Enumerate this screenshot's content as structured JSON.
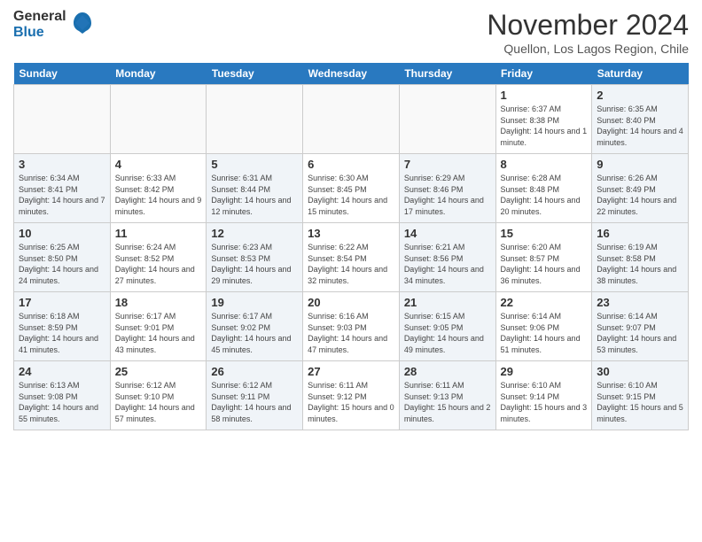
{
  "header": {
    "logo": {
      "general": "General",
      "blue": "Blue"
    },
    "title": "November 2024",
    "location": "Quellon, Los Lagos Region, Chile"
  },
  "weekdays": [
    "Sunday",
    "Monday",
    "Tuesday",
    "Wednesday",
    "Thursday",
    "Friday",
    "Saturday"
  ],
  "weeks": [
    [
      {
        "day": "",
        "info": ""
      },
      {
        "day": "",
        "info": ""
      },
      {
        "day": "",
        "info": ""
      },
      {
        "day": "",
        "info": ""
      },
      {
        "day": "",
        "info": ""
      },
      {
        "day": "1",
        "info": "Sunrise: 6:37 AM\nSunset: 8:38 PM\nDaylight: 14 hours and 1 minute."
      },
      {
        "day": "2",
        "info": "Sunrise: 6:35 AM\nSunset: 8:40 PM\nDaylight: 14 hours and 4 minutes."
      }
    ],
    [
      {
        "day": "3",
        "info": "Sunrise: 6:34 AM\nSunset: 8:41 PM\nDaylight: 14 hours and 7 minutes."
      },
      {
        "day": "4",
        "info": "Sunrise: 6:33 AM\nSunset: 8:42 PM\nDaylight: 14 hours and 9 minutes."
      },
      {
        "day": "5",
        "info": "Sunrise: 6:31 AM\nSunset: 8:44 PM\nDaylight: 14 hours and 12 minutes."
      },
      {
        "day": "6",
        "info": "Sunrise: 6:30 AM\nSunset: 8:45 PM\nDaylight: 14 hours and 15 minutes."
      },
      {
        "day": "7",
        "info": "Sunrise: 6:29 AM\nSunset: 8:46 PM\nDaylight: 14 hours and 17 minutes."
      },
      {
        "day": "8",
        "info": "Sunrise: 6:28 AM\nSunset: 8:48 PM\nDaylight: 14 hours and 20 minutes."
      },
      {
        "day": "9",
        "info": "Sunrise: 6:26 AM\nSunset: 8:49 PM\nDaylight: 14 hours and 22 minutes."
      }
    ],
    [
      {
        "day": "10",
        "info": "Sunrise: 6:25 AM\nSunset: 8:50 PM\nDaylight: 14 hours and 24 minutes."
      },
      {
        "day": "11",
        "info": "Sunrise: 6:24 AM\nSunset: 8:52 PM\nDaylight: 14 hours and 27 minutes."
      },
      {
        "day": "12",
        "info": "Sunrise: 6:23 AM\nSunset: 8:53 PM\nDaylight: 14 hours and 29 minutes."
      },
      {
        "day": "13",
        "info": "Sunrise: 6:22 AM\nSunset: 8:54 PM\nDaylight: 14 hours and 32 minutes."
      },
      {
        "day": "14",
        "info": "Sunrise: 6:21 AM\nSunset: 8:56 PM\nDaylight: 14 hours and 34 minutes."
      },
      {
        "day": "15",
        "info": "Sunrise: 6:20 AM\nSunset: 8:57 PM\nDaylight: 14 hours and 36 minutes."
      },
      {
        "day": "16",
        "info": "Sunrise: 6:19 AM\nSunset: 8:58 PM\nDaylight: 14 hours and 38 minutes."
      }
    ],
    [
      {
        "day": "17",
        "info": "Sunrise: 6:18 AM\nSunset: 8:59 PM\nDaylight: 14 hours and 41 minutes."
      },
      {
        "day": "18",
        "info": "Sunrise: 6:17 AM\nSunset: 9:01 PM\nDaylight: 14 hours and 43 minutes."
      },
      {
        "day": "19",
        "info": "Sunrise: 6:17 AM\nSunset: 9:02 PM\nDaylight: 14 hours and 45 minutes."
      },
      {
        "day": "20",
        "info": "Sunrise: 6:16 AM\nSunset: 9:03 PM\nDaylight: 14 hours and 47 minutes."
      },
      {
        "day": "21",
        "info": "Sunrise: 6:15 AM\nSunset: 9:05 PM\nDaylight: 14 hours and 49 minutes."
      },
      {
        "day": "22",
        "info": "Sunrise: 6:14 AM\nSunset: 9:06 PM\nDaylight: 14 hours and 51 minutes."
      },
      {
        "day": "23",
        "info": "Sunrise: 6:14 AM\nSunset: 9:07 PM\nDaylight: 14 hours and 53 minutes."
      }
    ],
    [
      {
        "day": "24",
        "info": "Sunrise: 6:13 AM\nSunset: 9:08 PM\nDaylight: 14 hours and 55 minutes."
      },
      {
        "day": "25",
        "info": "Sunrise: 6:12 AM\nSunset: 9:10 PM\nDaylight: 14 hours and 57 minutes."
      },
      {
        "day": "26",
        "info": "Sunrise: 6:12 AM\nSunset: 9:11 PM\nDaylight: 14 hours and 58 minutes."
      },
      {
        "day": "27",
        "info": "Sunrise: 6:11 AM\nSunset: 9:12 PM\nDaylight: 15 hours and 0 minutes."
      },
      {
        "day": "28",
        "info": "Sunrise: 6:11 AM\nSunset: 9:13 PM\nDaylight: 15 hours and 2 minutes."
      },
      {
        "day": "29",
        "info": "Sunrise: 6:10 AM\nSunset: 9:14 PM\nDaylight: 15 hours and 3 minutes."
      },
      {
        "day": "30",
        "info": "Sunrise: 6:10 AM\nSunset: 9:15 PM\nDaylight: 15 hours and 5 minutes."
      }
    ]
  ]
}
